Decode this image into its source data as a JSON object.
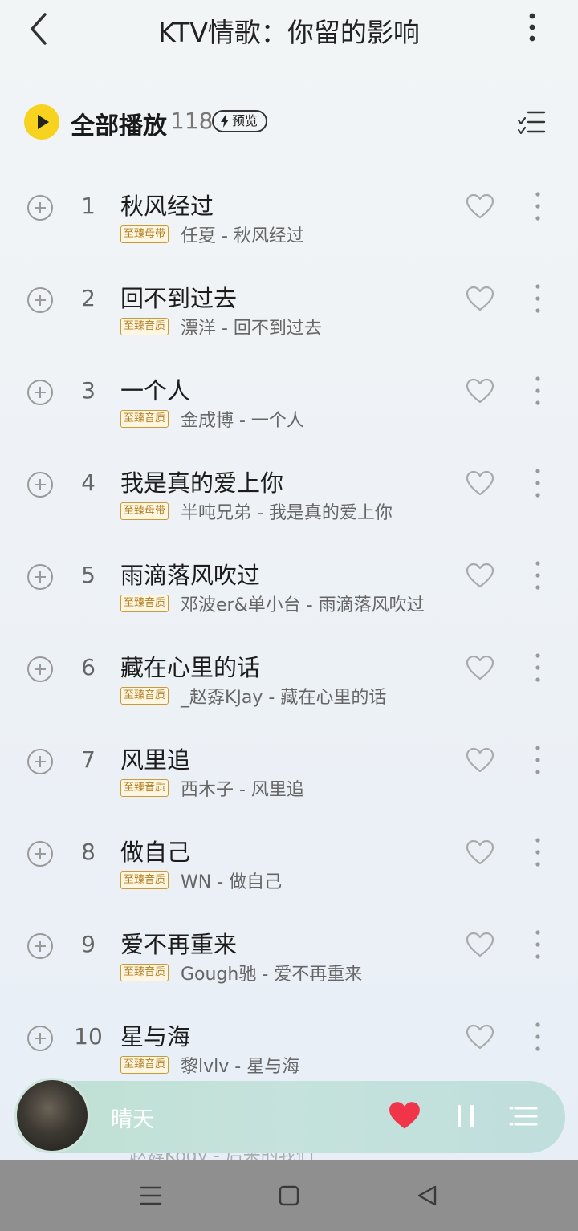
{
  "header": {
    "title": "KTV情歌：你留的影响"
  },
  "playall": {
    "label": "全部播放",
    "count": "118",
    "preview_label": "预览"
  },
  "songs": [
    {
      "index": "1",
      "title": "秋风经过",
      "badge": "至臻母带",
      "subtitle": "任夏 - 秋风经过"
    },
    {
      "index": "2",
      "title": "回不到过去",
      "badge": "至臻音质",
      "subtitle": "漂洋 - 回不到过去"
    },
    {
      "index": "3",
      "title": "一个人",
      "badge": "至臻音质",
      "subtitle": "金成博 - 一个人"
    },
    {
      "index": "4",
      "title": "我是真的爱上你",
      "badge": "至臻母带",
      "subtitle": "半吨兄弟 - 我是真的爱上你"
    },
    {
      "index": "5",
      "title": "雨滴落风吹过",
      "badge": "至臻音质",
      "subtitle": "邓波er&单小台 - 雨滴落风吹过"
    },
    {
      "index": "6",
      "title": "藏在心里的话",
      "badge": "至臻音质",
      "subtitle": "_赵孬KJay - 藏在心里的话"
    },
    {
      "index": "7",
      "title": "风里追",
      "badge": "至臻音质",
      "subtitle": "西木子 - 风里追"
    },
    {
      "index": "8",
      "title": "做自己",
      "badge": "至臻音质",
      "subtitle": "WN - 做自己"
    },
    {
      "index": "9",
      "title": "爱不再重来",
      "badge": "至臻音质",
      "subtitle": "Gough驰 - 爱不再重来"
    },
    {
      "index": "10",
      "title": "星与海",
      "badge": "至臻音质",
      "subtitle": "黎lvlv - 星与海"
    }
  ],
  "partial_row": {
    "subtitle": "_赵孬Kody - 后来的我们"
  },
  "player": {
    "title": "晴天",
    "liked": true,
    "like_color": "#f0344a",
    "state": "playing"
  },
  "colors": {
    "play_button": "#f7d21e",
    "badge_text": "#b27f22",
    "navbar": "#8f8f8f"
  },
  "icons": [
    "back-icon",
    "more-vertical-icon",
    "play-icon",
    "lightning-icon",
    "list-manage-icon",
    "plus-circle-icon",
    "heart-outline-icon",
    "heart-filled-icon",
    "pause-icon",
    "playlist-icon",
    "nav-menu-icon",
    "nav-home-icon",
    "nav-back-icon"
  ]
}
